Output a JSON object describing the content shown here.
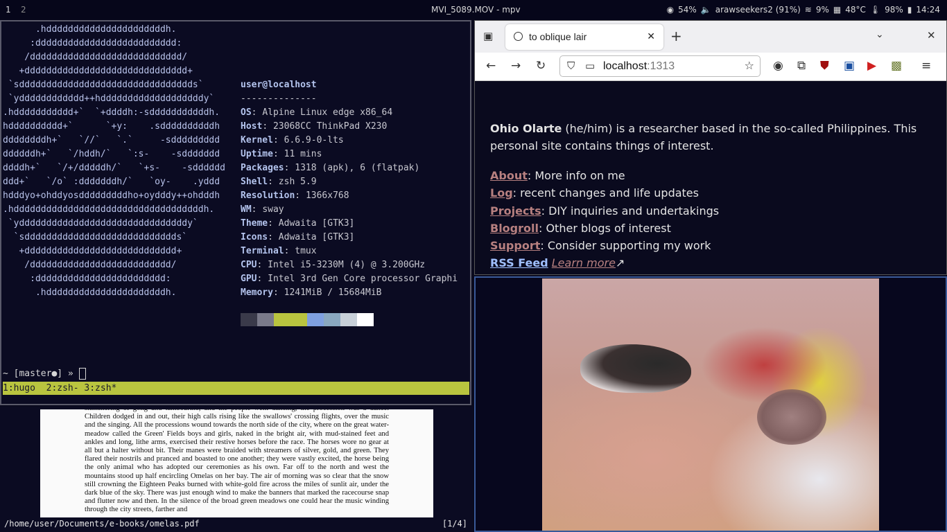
{
  "topbar": {
    "workspace_1": "1",
    "workspace_2": "2",
    "window_title": "MVI_5089.MOV - mpv",
    "volume": "54%",
    "network": "arawseekers2 (91%)",
    "cpu": "9%",
    "temp": "48°C",
    "battery": "98%",
    "clock": "14:24"
  },
  "terminal": {
    "logo_lines": [
      "      .hddddddddddddddddddddddh.",
      "     :dddddddddddddddddddddddddd:",
      "    /dddddddddddddddddddddddddddd/",
      "   +dddddddddddddddddddddddddddddd+",
      " `sdddddddddddddddddddddddddddddddds`",
      " `ydddddddddddd++hdddddddddddddddddddy`",
      ".hddddddddddd+`  `+ddddh:-sdddddddddddh.",
      "hdddddddddd+`      `+y:    .sddddddddddh",
      "ddddddddh+`   `//`   `.`     -sddddddddd",
      "ddddddh+`   `/hddh/`   `:s-    -sddddddd",
      "ddddh+`   `/+/dddddh/`   `+s-    -sdddddd",
      "ddd+`   `/o` :dddddddh/`   `oy-    .yddd",
      "hdddyo+ohddyosdddddddddho+oydddy++ohdddh",
      ".hdddddddddddddddddddddddddddddddddddh.",
      " `ydddddddddddddddddddddddddddddddy`",
      "  `sdddddddddddddddddddddddddddds`",
      "   +dddddddddddddddddddddddddddd+",
      "    /dddddddddddddddddddddddddd/",
      "     :dddddddddddddddddddddddd:",
      "      .hddddddddddddddddddddddh."
    ],
    "user_host": "user@localhost",
    "separator": "--------------",
    "info": [
      {
        "key": "OS",
        "value": "Alpine Linux edge x86_64"
      },
      {
        "key": "Host",
        "value": "23068CC ThinkPad X230"
      },
      {
        "key": "Kernel",
        "value": "6.6.9-0-lts"
      },
      {
        "key": "Uptime",
        "value": "11 mins"
      },
      {
        "key": "Packages",
        "value": "1318 (apk), 6 (flatpak)"
      },
      {
        "key": "Shell",
        "value": "zsh 5.9"
      },
      {
        "key": "Resolution",
        "value": "1366x768"
      },
      {
        "key": "WM",
        "value": "sway"
      },
      {
        "key": "Theme",
        "value": "Adwaita [GTK3]"
      },
      {
        "key": "Icons",
        "value": "Adwaita [GTK3]"
      },
      {
        "key": "Terminal",
        "value": "tmux"
      },
      {
        "key": "CPU",
        "value": "Intel i5-3230M (4) @ 3.200GHz"
      },
      {
        "key": "GPU",
        "value": "Intel 3rd Gen Core processor Graphi"
      },
      {
        "key": "Memory",
        "value": "1241MiB / 15684MiB"
      }
    ],
    "swatch_colors": [
      "#3a3a4a",
      "#7a7a8a",
      "#b9c43f",
      "#b9c43f",
      "#7fa0e0",
      "#8aa8c0",
      "#c8d0d8",
      "#ffffff"
    ],
    "prompt": "~ [master●] » ",
    "tmux_status": "1:hugo  2:zsh- 3:zsh*"
  },
  "pdf": {
    "text": "shimmering of gong and tambourine, and the people went dancing, the procession was a dance. Children dodged in and out, their high calls rising like the swallows' crossing flights, over the music and the singing. All the processions wound towards the north side of the city, where on the great water-meadow called the Green' Fields boys and girls, naked in the bright air, with mud-stained feet and ankles and long, lithe arms, exercised their restive horses before the race. The horses wore no gear at all but a halter without bit. Their manes were braided with streamers of silver, gold, and green. They flared their nostrils and pranced and boasted to one another; they were vastly excited, the horse being the only animal who has adopted our ceremonies as his own. Far off to the north and west the mountains stood up half encircling Omelas on her bay. The air of morning was so clear that the snow still crowning the Eighteen Peaks burned with white-gold fire across the miles of sunlit air, under the dark blue of the sky. There was just enough wind to make the banners that marked the racecourse snap and flutter now and then. In the silence of the broad green meadows one could hear the music winding through the city streets, farther and",
    "path": "/home/user/Documents/e-books/omelas.pdf",
    "page_indicator": "[1/4]"
  },
  "browser": {
    "tab_title": "to oblique lair",
    "url_host": "localhost",
    "url_port": ":1313",
    "intro_name": "Ohio Olarte",
    "intro_rest": " (he/him) is a researcher based in the so-called Philippines. This personal site contains things of interest.",
    "links": [
      {
        "label": "About",
        "desc": ": More info on me"
      },
      {
        "label": "Log",
        "desc": ": recent changes and life updates"
      },
      {
        "label": "Projects",
        "desc": ": DIY inquiries and undertakings"
      },
      {
        "label": "Blogroll",
        "desc": ": Other blogs of interest"
      },
      {
        "label": "Support",
        "desc": ": Consider supporting my work"
      }
    ],
    "rss_label": "RSS Feed",
    "learn_more": "Learn more",
    "external_mark": "↗"
  }
}
